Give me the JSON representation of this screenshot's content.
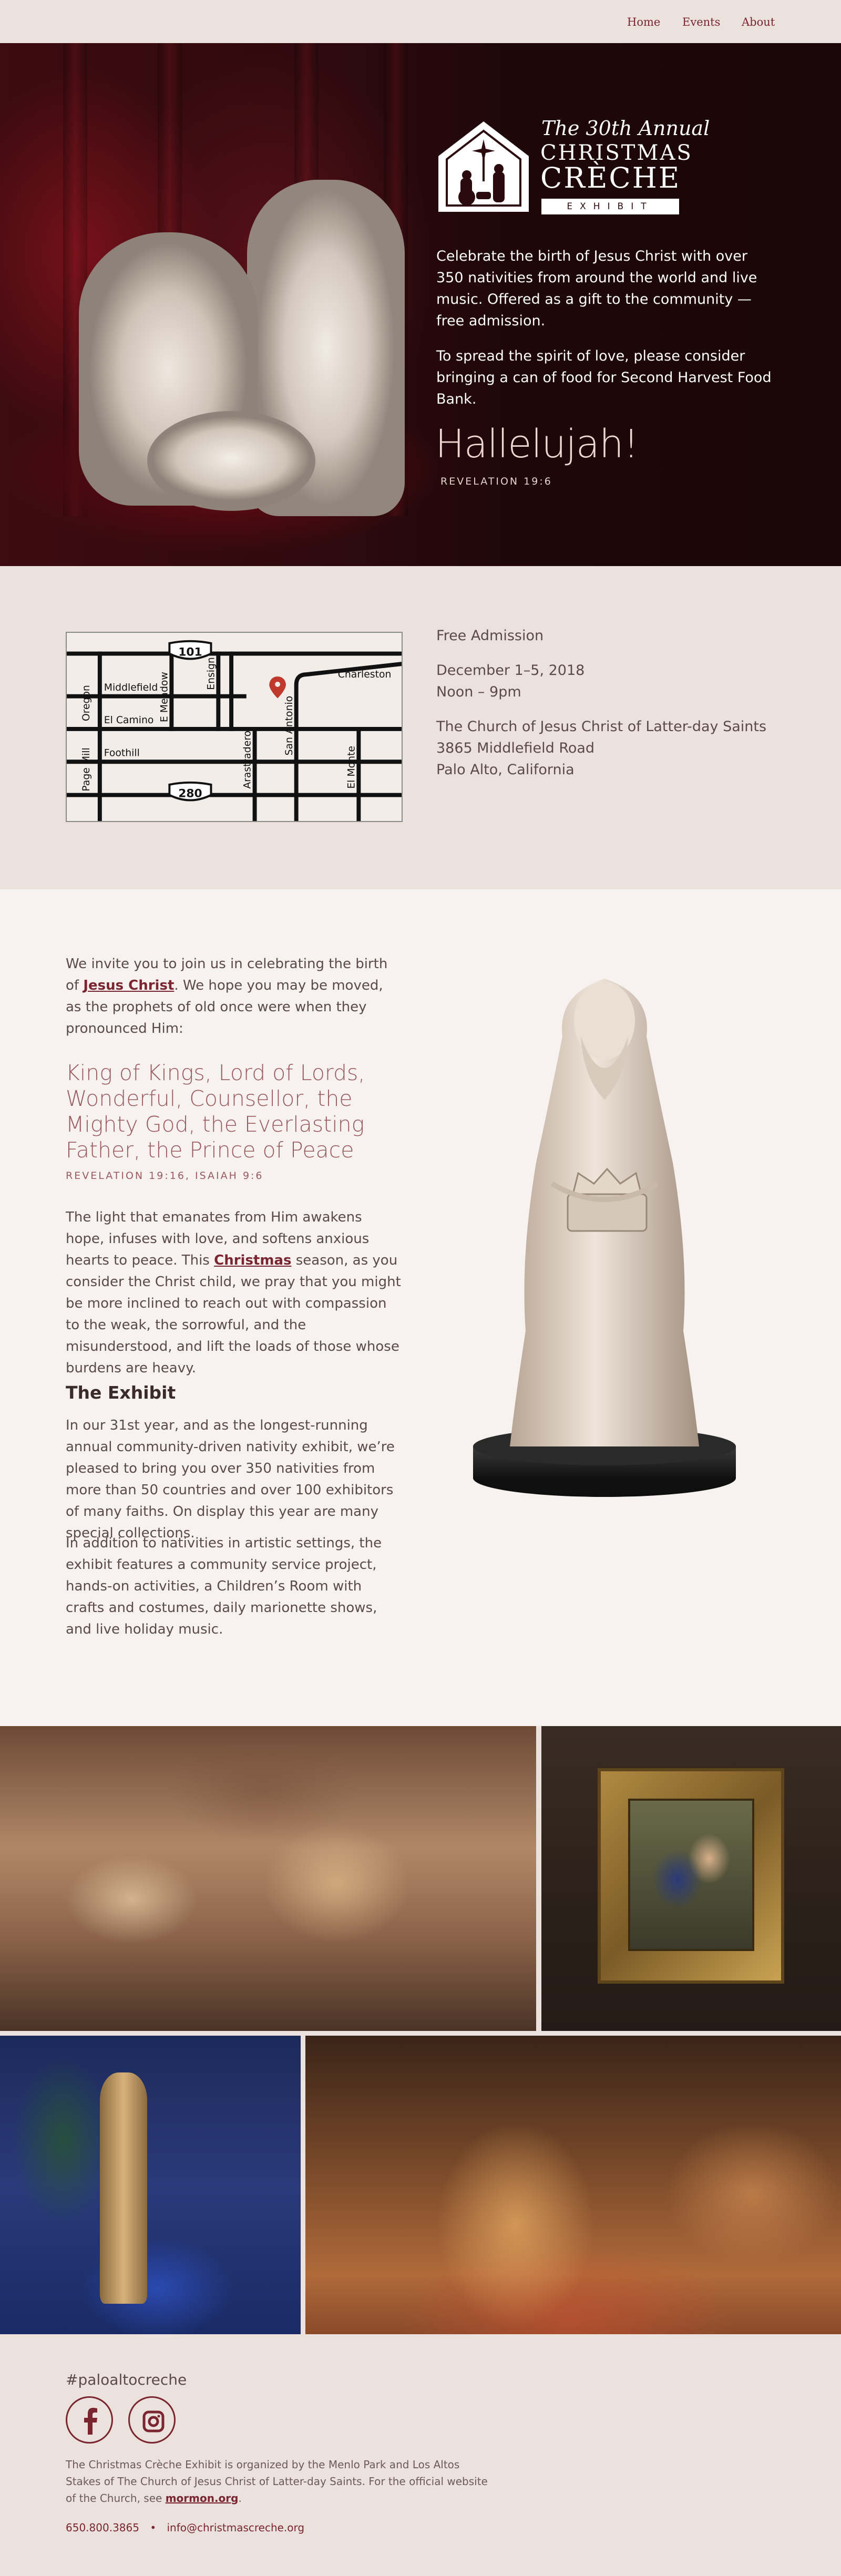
{
  "nav": {
    "home": "Home",
    "events": "Events",
    "about": "About"
  },
  "hero": {
    "logo": {
      "annual": "The 30th Annual",
      "christmas": "CHRISTMAS",
      "creche": "CRÈCHE",
      "exhibit": "EXHIBIT"
    },
    "intro": "Celebrate the birth of Jesus Christ with over 350 nativities from around the world and live music. Offered as a gift to the community — free admission.",
    "food_drive": "To spread the spirit of love, please consider bringing a can of food for Second Harvest Food Bank.",
    "hallelujah": "Hallelujah!",
    "reference": "REVELATION 19:6"
  },
  "map": {
    "streets": {
      "middlefield": "Middlefield",
      "el_camino": "El Camino",
      "foothill": "Foothill",
      "oregon": "Oregon",
      "page_mill": "Page Mill",
      "e_meadow": "E Meadow",
      "ensign": "Ensign",
      "charleston": "Charleston",
      "arastradero": "Arastradero",
      "san_antonio": "San Antonio",
      "el_monte": "El Monte"
    },
    "shields": {
      "hwy_101": "101",
      "hwy_280": "280"
    },
    "pin_color": "#c0392b"
  },
  "info": {
    "admission": "Free Admission",
    "dates": "December 1–5, 2018",
    "hours": "Noon – 9pm",
    "venue": "The Church of Jesus Christ of Latter-day Saints",
    "address": "3865 Middlefield Road",
    "city": "Palo Alto, California"
  },
  "invite": {
    "p1_before": "We invite you to join us in celebrating the birth of ",
    "p1_link": "Jesus Christ",
    "p1_after": ". We hope you may be moved, as the prophets of old once were when they pronounced Him:",
    "quote": "King of Kings, Lord of Lords, Wonderful, Counsellor, the Mighty God, the Everlasting Father, the Prince of Peace",
    "quote_ref": "REVELATION 19:16, ISAIAH 9:6",
    "p2_before": "The light that emanates from Him awakens hope, infuses with love, and softens anxious hearts to peace. This ",
    "p2_link": "Christmas",
    "p2_after": " season, as you consider the Christ child, we pray that you might be more inclined to reach out with compassion to the weak, the sorrowful, and the misunderstood, and lift the loads of those whose burdens are heavy.",
    "exhibit_heading": "The Exhibit",
    "p3": "In our 31st year, and as the longest-running annual community-driven nativity exhibit, we’re pleased to bring you over 350 nativities from more than 50 countries and over 100 exhibitors of many faiths. On display this year are many special collections.",
    "p4": "In addition to nativities in artistic settings, the exhibit features a community service project, hands-on activities, a Children’s Room with crafts and costumes, daily marionette shows, and live holiday music."
  },
  "footer": {
    "hashtag": "#paloaltocreche",
    "note_before": "The Christmas Crèche Exhibit is organized by the Menlo Park and Los Altos Stakes of The Church of Jesus Christ of Latter-day Saints. For the official website of the Church, see ",
    "note_link": "mormon.org",
    "note_after": ".",
    "phone": "650.800.3865",
    "separator": "•",
    "email": "info@christmascreche.org"
  },
  "colors": {
    "accent": "#7a2530",
    "background": "#ebe1dd",
    "hero_bg": "#1f0709"
  },
  "icons": {
    "facebook": "facebook-icon",
    "instagram": "instagram-icon",
    "map_pin": "map-pin-icon"
  }
}
